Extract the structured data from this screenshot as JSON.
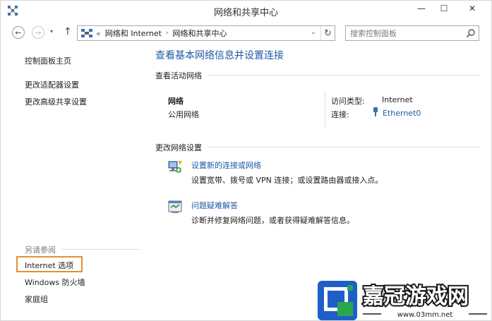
{
  "window": {
    "title": "网络和共享中心",
    "controls": {
      "minimize": "—",
      "maximize": "☐",
      "close": "✕"
    }
  },
  "navigation": {
    "back_glyph": "←",
    "forward_glyph": "→",
    "dropdown_glyph": "▾",
    "up_glyph": "↑",
    "breadcrumb_prefix": "«",
    "breadcrumbs": [
      "网络和 Internet",
      "网络和共享中心"
    ],
    "breadcrumb_sep": "›",
    "address_dropdown": "⌄",
    "refresh_glyph": "↻"
  },
  "search": {
    "placeholder": "搜索控制面板"
  },
  "sidebar": {
    "items": [
      {
        "label": "控制面板主页"
      },
      {
        "label": "更改适配器设置"
      },
      {
        "label": "更改高级共享设置"
      }
    ],
    "see_also_title": "另请参阅",
    "see_also": [
      {
        "label": "Internet 选项"
      },
      {
        "label": "Windows 防火墙"
      },
      {
        "label": "家庭组"
      }
    ]
  },
  "main": {
    "title": "查看基本网络信息并设置连接",
    "active_networks": {
      "heading": "查看活动网络",
      "network_name": "网络",
      "network_category": "公用网络",
      "access_type_label": "访问类型:",
      "access_type_value": "Internet",
      "connections_label": "连接:",
      "connections_value": "Ethernet0"
    },
    "change_settings": {
      "heading": "更改网络设置",
      "tasks": [
        {
          "link": "设置新的连接或网络",
          "desc": "设置宽带、拨号或 VPN 连接；或设置路由器或接入点。"
        },
        {
          "link": "问题疑难解答",
          "desc": "诊断并修复网络问题，或者获得疑难解答信息。"
        }
      ]
    }
  },
  "watermark": {
    "brand": "嘉冠游戏网",
    "url": "www.03mm.net"
  },
  "colors": {
    "link": "#1f5aa6",
    "highlight": "#e0913a",
    "logo_blue": "#1d5fc7",
    "logo_green": "#2aa64b"
  }
}
